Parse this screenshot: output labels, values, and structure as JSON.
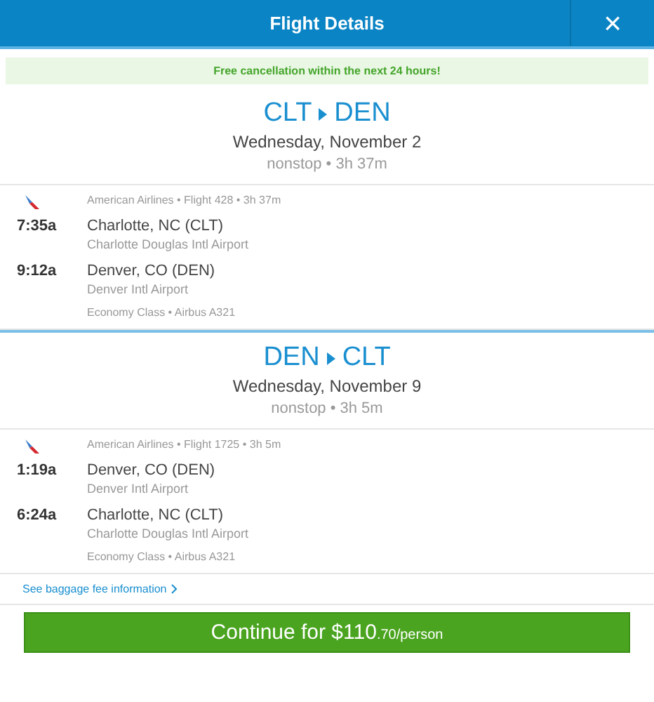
{
  "window": {
    "title": "Flight Details",
    "close": "×"
  },
  "notice": "Free cancellation within the next 24 hours!",
  "legs": [
    {
      "from": "CLT",
      "to": "DEN",
      "date": "Wednesday, November 2",
      "summary": "nonstop • 3h 37m",
      "flight": "American Airlines • Flight 428 • 3h 37m",
      "stops": [
        {
          "time": "7:35a",
          "city": "Charlotte, NC (CLT)",
          "airport": "Charlotte Douglas Intl Airport"
        },
        {
          "time": "9:12a",
          "city": "Denver, CO (DEN)",
          "airport": "Denver Intl Airport"
        }
      ],
      "cabin": "Economy Class • Airbus A321"
    },
    {
      "from": "DEN",
      "to": "CLT",
      "date": "Wednesday, November 9",
      "summary": "nonstop • 3h 5m",
      "flight": "American Airlines • Flight 1725 • 3h 5m",
      "stops": [
        {
          "time": "1:19a",
          "city": "Denver, CO (DEN)",
          "airport": "Denver Intl Airport"
        },
        {
          "time": "6:24a",
          "city": "Charlotte, NC (CLT)",
          "airport": "Charlotte Douglas Intl Airport"
        }
      ],
      "cabin": "Economy Class • Airbus A321"
    }
  ],
  "baggage_link": "See baggage fee information",
  "continue_button": {
    "label": "Continue for $110",
    "cents": ".70/person"
  }
}
